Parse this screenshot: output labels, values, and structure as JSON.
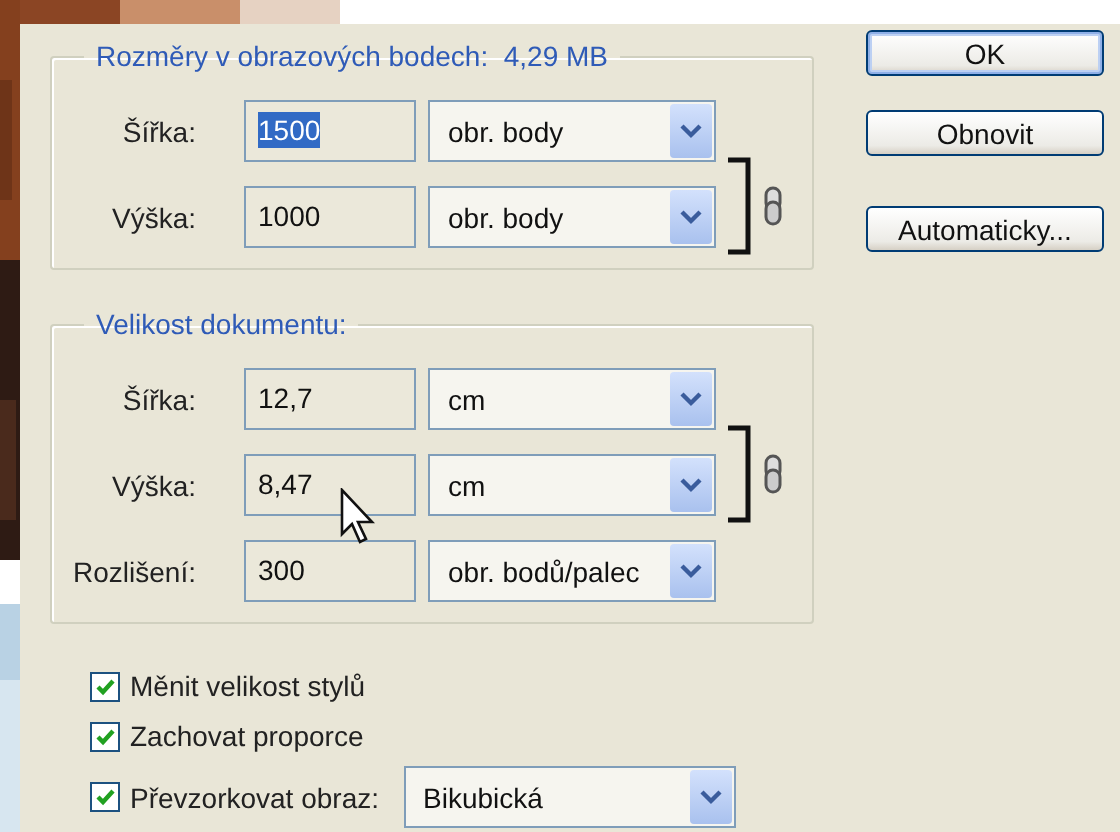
{
  "pixel_dimensions": {
    "title": "Rozměry v obrazových bodech:  4,29 MB",
    "linked": true,
    "rows": [
      {
        "label": "Šířka:",
        "value": "1500",
        "value_selected": true,
        "unit": "obr. body"
      },
      {
        "label": "Výška:",
        "value": "1000",
        "value_selected": false,
        "unit": "obr. body"
      }
    ]
  },
  "document_size": {
    "title": "Velikost dokumentu:",
    "linked": true,
    "rows": [
      {
        "label": "Šířka:",
        "value": "12,7",
        "value_selected": false,
        "unit": "cm"
      },
      {
        "label": "Výška:",
        "value": "8,47",
        "value_selected": false,
        "unit": "cm"
      },
      {
        "label": "Rozlišení:",
        "value": "300",
        "value_selected": false,
        "unit": "obr. bodů/palec"
      }
    ]
  },
  "checkboxes": [
    {
      "label": "Měnit velikost stylů",
      "checked": true
    },
    {
      "label": "Zachovat proporce",
      "checked": true
    },
    {
      "label": "Převzorkovat obraz:",
      "checked": true,
      "dropdown": "Bikubická"
    }
  ],
  "buttons": [
    {
      "label": "OK",
      "default": true
    },
    {
      "label": "Obnovit",
      "default": false
    },
    {
      "label": "Automaticky...",
      "default": false
    }
  ]
}
